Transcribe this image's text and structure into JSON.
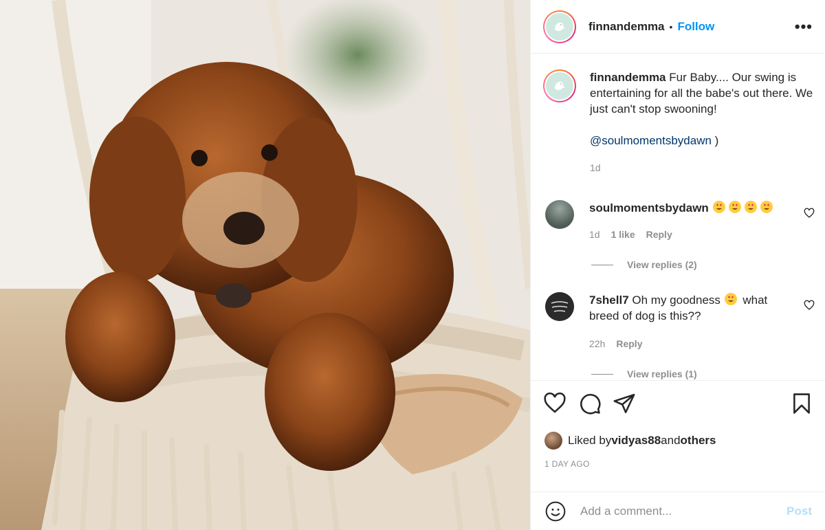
{
  "post": {
    "username": "finnandemma",
    "follow_label": "Follow",
    "separator": "•",
    "more_label": "•••"
  },
  "caption": {
    "username": "finnandemma",
    "text_line1": " Fur Baby.... Our swing is entertaining for all the babe's out there. We just can't stop swooning!",
    "mention": "@soulmomentsbydawn",
    "mention_suffix": " )",
    "time": "1d"
  },
  "comments": [
    {
      "username": "soulmomentsbydawn",
      "text": "",
      "emoji_count": 4,
      "time": "1d",
      "likes": "1 like",
      "reply_label": "Reply",
      "view_replies": "View replies (2)"
    },
    {
      "username": "7shell7",
      "text_before": " Oh my goodness ",
      "text_after": " what breed of dog is this??",
      "time": "22h",
      "reply_label": "Reply",
      "view_replies": "View replies (1)"
    }
  ],
  "likes": {
    "prefix": "Liked by ",
    "user": "vidyas88",
    "middle": " and ",
    "others": "others"
  },
  "timestamp": "1 DAY AGO",
  "add_comment": {
    "placeholder": "Add a comment...",
    "post_label": "Post"
  },
  "colors": {
    "accent": "#0095f6",
    "muted": "#8e8e8e",
    "post_disabled": "#b2dffc",
    "mention": "#00376b"
  },
  "icons": [
    "heart-icon",
    "comment-icon",
    "share-icon",
    "bookmark-icon",
    "smile-icon",
    "more-icon"
  ]
}
